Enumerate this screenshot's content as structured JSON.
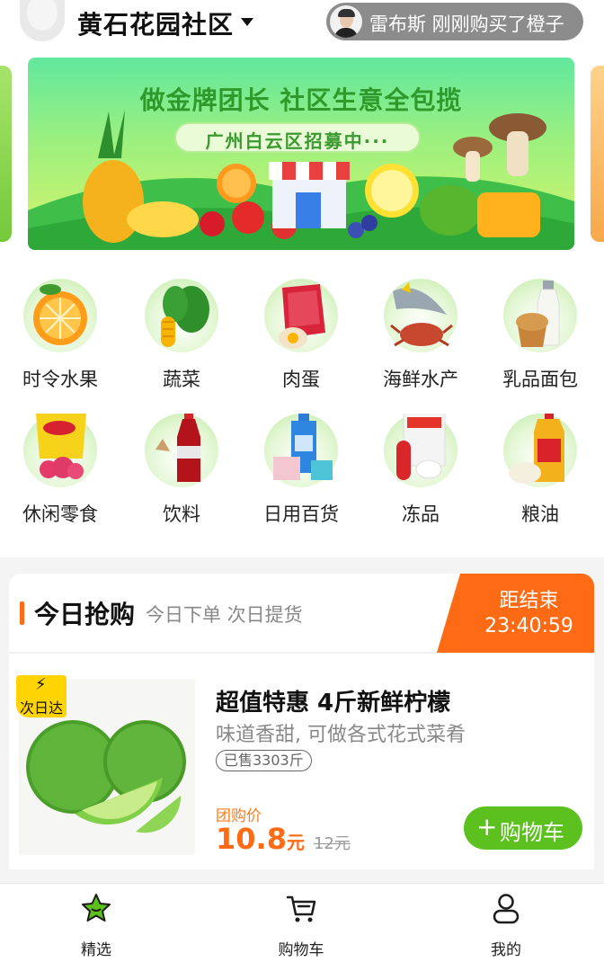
{
  "header": {
    "community_name": "黄石花园社区",
    "ticker_text": "雷布斯 刚刚购买了橙子"
  },
  "banner": {
    "title": "做金牌团长 社区生意全包揽",
    "subtitle": "广州白云区招募中···"
  },
  "categories": [
    {
      "label": "时令水果",
      "icon": "orange-icon"
    },
    {
      "label": "蔬菜",
      "icon": "vegetables-icon"
    },
    {
      "label": "肉蛋",
      "icon": "meat-egg-icon"
    },
    {
      "label": "海鲜水产",
      "icon": "seafood-icon"
    },
    {
      "label": "乳品面包",
      "icon": "milk-bread-icon"
    },
    {
      "label": "休闲零食",
      "icon": "snacks-icon"
    },
    {
      "label": "饮料",
      "icon": "cola-icon"
    },
    {
      "label": "日用百货",
      "icon": "daily-goods-icon"
    },
    {
      "label": "冻品",
      "icon": "frozen-food-icon"
    },
    {
      "label": "粮油",
      "icon": "oil-rice-icon"
    }
  ],
  "flash_sale": {
    "title": "今日抢购",
    "subtitle": "今日下单 次日提货",
    "countdown_label": "距结束",
    "countdown_time": "23:40:59"
  },
  "product": {
    "badge": "次日达",
    "title": "超值特惠 4斤新鲜柠檬",
    "description": "味道香甜, 可做各式花式菜肴",
    "sold": "已售3303斤",
    "group_price_label": "团购价",
    "price": "10.8",
    "price_unit": "元",
    "original_price": "12元",
    "cart_button": "购物车"
  },
  "tabbar": {
    "tabs": [
      {
        "label": "精选",
        "icon": "star-bag-icon"
      },
      {
        "label": "购物车",
        "icon": "cart-icon"
      },
      {
        "label": "我的",
        "icon": "user-icon"
      }
    ]
  },
  "colors": {
    "accent_orange": "#ff6a14",
    "accent_green": "#5cc11f",
    "ticker_bg": "#8c8c8c"
  }
}
